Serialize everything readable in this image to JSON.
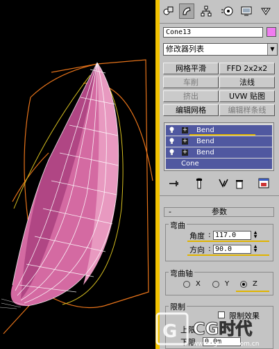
{
  "panel": {
    "object_name": "Cone13",
    "object_color": "#f07cf0",
    "modifier_list": "修改器列表",
    "buttons": [
      "网格平滑",
      "FFD 2x2x2",
      "车削",
      "法线",
      "挤出",
      "UVW 贴图",
      "编辑网格",
      "编辑样条线"
    ],
    "stack": [
      "Bend",
      "Bend",
      "Bend",
      "Cone"
    ],
    "rollout_title": "参数",
    "bend_group": "弯曲",
    "angle_label": "角度",
    "angle_value": "117.0",
    "direction_label": "方向",
    "direction_value": "90.0",
    "axis_group": "弯曲轴",
    "axes": [
      "X",
      "Y",
      "Z"
    ],
    "selected_axis": "Z",
    "limit_group": "限制",
    "limit_effect": "限制效果",
    "upper_limit": "上限",
    "lower_limit": "下限",
    "lower_value": "0.0m"
  },
  "watermark": "CG时代",
  "watermark_url": "www.cgtimes.com.cn",
  "icons": [
    "create-icon",
    "modify-icon",
    "hierarchy-icon",
    "motion-icon",
    "display-icon",
    "utilities-icon"
  ]
}
